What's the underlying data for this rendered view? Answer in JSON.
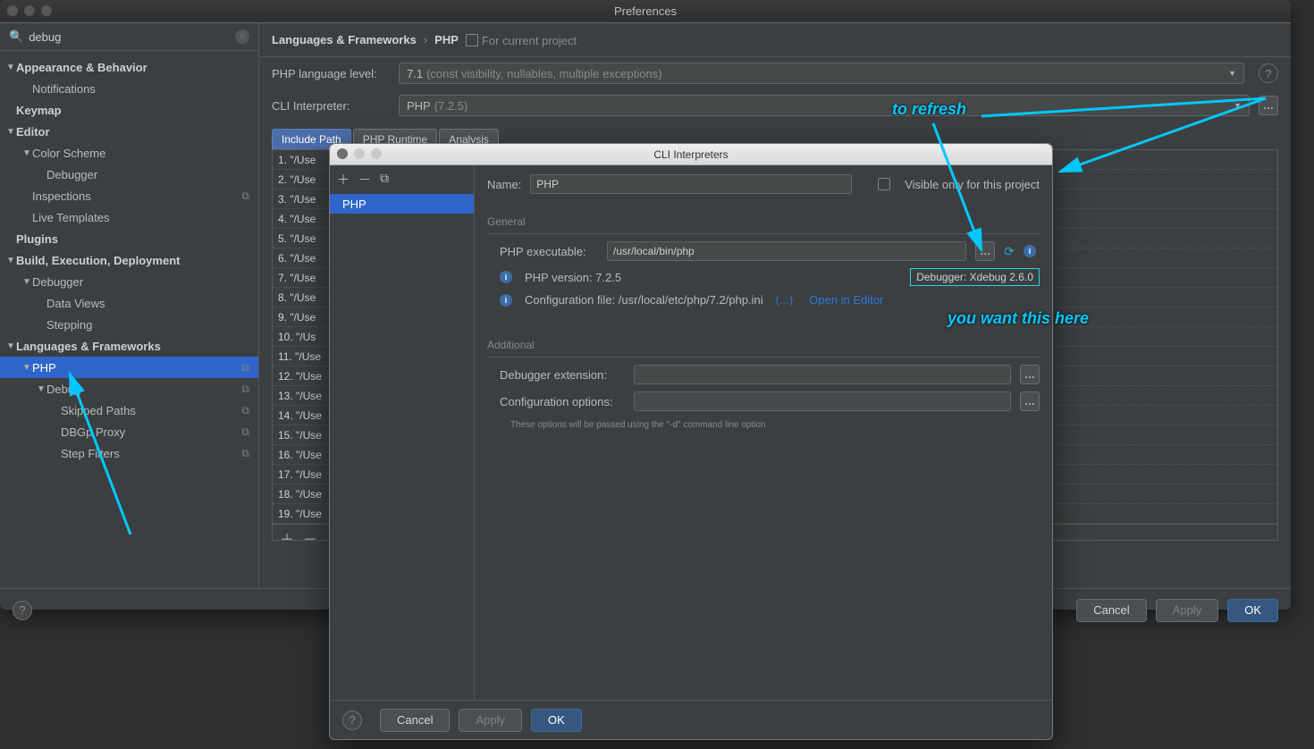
{
  "prefs": {
    "title": "Preferences",
    "search": {
      "value": "debug"
    },
    "tree": {
      "appearance": "Appearance & Behavior",
      "notifications": "Notifications",
      "keymap": "Keymap",
      "editor": "Editor",
      "color_scheme": "Color Scheme",
      "debugger_cs": "Debugger",
      "inspections": "Inspections",
      "live_templates": "Live Templates",
      "plugins": "Plugins",
      "bed": "Build, Execution, Deployment",
      "debugger": "Debugger",
      "data_views": "Data Views",
      "stepping": "Stepping",
      "langs": "Languages & Frameworks",
      "php": "PHP",
      "debug": "Debug",
      "skipped": "Skipped Paths",
      "dbgp": "DBGp Proxy",
      "step_filters": "Step Filters"
    },
    "breadcrumb": {
      "root": "Languages & Frameworks",
      "leaf": "PHP",
      "scope": "For current project"
    },
    "form": {
      "lang_level_label": "PHP language level:",
      "lang_level_value": "7.1",
      "lang_level_hint": "(const visibility, nullables, multiple exceptions)",
      "cli_interpreter_label": "CLI Interpreter:",
      "cli_interpreter_value": "PHP",
      "cli_interpreter_hint": "(7.2.5)"
    },
    "tabs": {
      "include_path": "Include Path",
      "php_runtime": "PHP Runtime",
      "analysis": "Analysis"
    },
    "paths": [
      "1. \"/Use",
      "2. \"/Use",
      "3. \"/Use",
      "4. \"/Use",
      "5. \"/Use",
      "6. \"/Use",
      "7. \"/Use",
      "8. \"/Use",
      "9. \"/Use",
      "10. \"/Us",
      "11. \"/Use",
      "12. \"/Use",
      "13. \"/Use",
      "14. \"/Use",
      "15. \"/Use",
      "16. \"/Use",
      "17. \"/Use",
      "18. \"/Use",
      "19. \"/Use"
    ],
    "buttons": {
      "cancel": "Cancel",
      "apply": "Apply",
      "ok": "OK"
    }
  },
  "cli": {
    "title": "CLI Interpreters",
    "list_item": "PHP",
    "name_label": "Name:",
    "name_value": "PHP",
    "visible_label": "Visible only for this project",
    "general_header": "General",
    "exe_label": "PHP executable:",
    "exe_value": "/usr/local/bin/php",
    "version_line": "PHP version: 7.2.5",
    "debugger_badge": "Debugger: Xdebug 2.6.0",
    "conf_line": "Configuration file: /usr/local/etc/php/7.2/php.ini",
    "conf_ellipsis": "(...)",
    "open_in_editor": "Open in Editor",
    "additional_header": "Additional",
    "dbg_ext_label": "Debugger extension:",
    "conf_opts_label": "Configuration options:",
    "small_note": "These options will be passed using the \"-d\" command line option",
    "buttons": {
      "cancel": "Cancel",
      "apply": "Apply",
      "ok": "OK"
    }
  },
  "annotations": {
    "to_refresh": "to refresh",
    "you_want": "you want this here"
  }
}
